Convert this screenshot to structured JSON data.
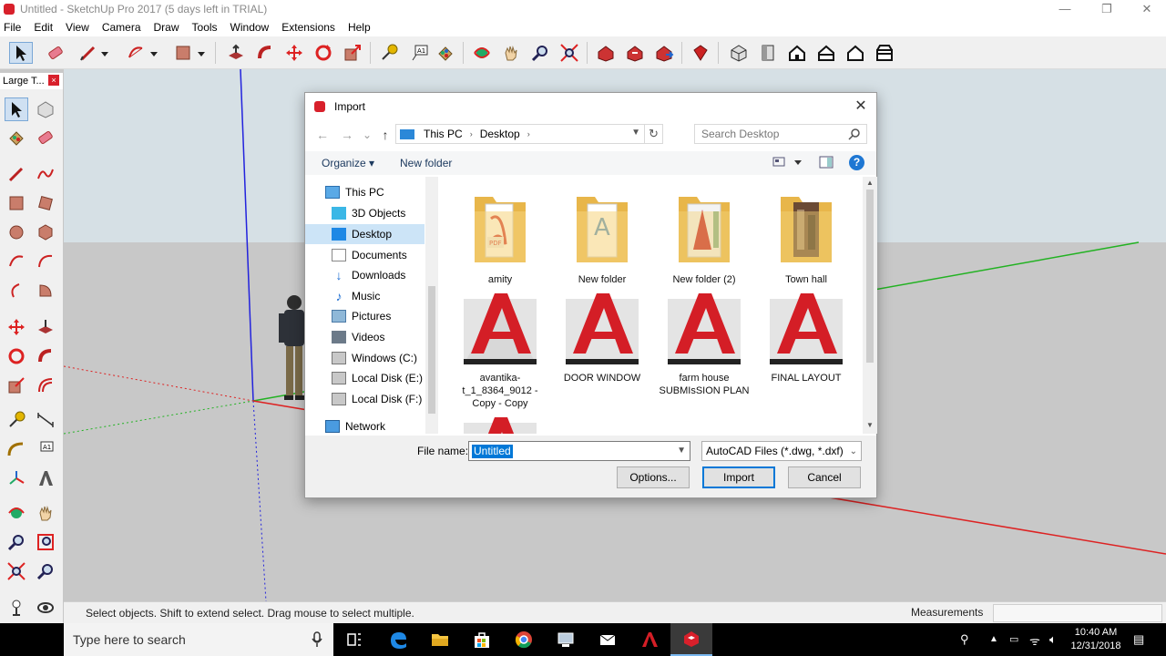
{
  "window": {
    "title": "Untitled - SketchUp Pro 2017 (5 days left in TRIAL)",
    "minimize_glyph": "—",
    "maximize_glyph": "❐",
    "close_glyph": "✕"
  },
  "menu": [
    "File",
    "Edit",
    "View",
    "Camera",
    "Draw",
    "Tools",
    "Window",
    "Extensions",
    "Help"
  ],
  "left_tray": {
    "title": "Large T...",
    "close_glyph": "×"
  },
  "status": {
    "hint": "Select objects. Shift to extend select. Drag mouse to select multiple.",
    "measurements_label": "Measurements"
  },
  "dialog": {
    "title": "Import",
    "close_glyph": "✕",
    "nav": {
      "back": "←",
      "forward": "→",
      "recent": "⌄",
      "up": "↑",
      "refresh": "↻"
    },
    "address": {
      "crumbs": [
        "This PC",
        "Desktop"
      ],
      "separator": "›"
    },
    "search_placeholder": "Search Desktop",
    "commands": {
      "organize": "Organize ▾",
      "new_folder": "New folder",
      "help": "?"
    },
    "nav_pane": [
      {
        "label": "This PC",
        "icon": "computer-icon"
      },
      {
        "label": "3D Objects",
        "icon": "3d-objects-icon"
      },
      {
        "label": "Desktop",
        "icon": "desktop-icon",
        "selected": true
      },
      {
        "label": "Documents",
        "icon": "documents-icon"
      },
      {
        "label": "Downloads",
        "icon": "downloads-icon"
      },
      {
        "label": "Music",
        "icon": "music-icon"
      },
      {
        "label": "Pictures",
        "icon": "pictures-icon"
      },
      {
        "label": "Videos",
        "icon": "videos-icon"
      },
      {
        "label": "Windows (C:)",
        "icon": "drive-icon"
      },
      {
        "label": "Local Disk (E:)",
        "icon": "drive-icon"
      },
      {
        "label": "Local Disk (F:)",
        "icon": "drive-icon"
      },
      {
        "label": "Network",
        "icon": "network-icon"
      }
    ],
    "files": [
      {
        "label": "amity",
        "kind": "folder-pdf"
      },
      {
        "label": "New folder",
        "kind": "folder-doc"
      },
      {
        "label": "New folder (2)",
        "kind": "folder-autocad"
      },
      {
        "label": "Town hall",
        "kind": "folder-photo"
      },
      {
        "label": "avantika-t_1_8364_9012 - Copy - Copy",
        "kind": "dwg"
      },
      {
        "label": "DOOR WINDOW",
        "kind": "dwg"
      },
      {
        "label": "farm house SUBMIsSION PLAN",
        "kind": "dwg"
      },
      {
        "label": "FINAL LAYOUT",
        "kind": "dwg"
      }
    ],
    "file_name_label": "File name:",
    "file_name_value": "Untitled",
    "file_type": "AutoCAD Files (*.dwg, *.dxf)",
    "buttons": {
      "options": "Options...",
      "import": "Import",
      "cancel": "Cancel"
    }
  },
  "taskbar": {
    "search_placeholder": "Type here to search",
    "time": "10:40 AM",
    "date": "12/31/2018"
  },
  "colors": {
    "sketchup_red": "#d8202b",
    "selection_blue": "#0078d7",
    "folder_yellow": "#f5d37b"
  }
}
